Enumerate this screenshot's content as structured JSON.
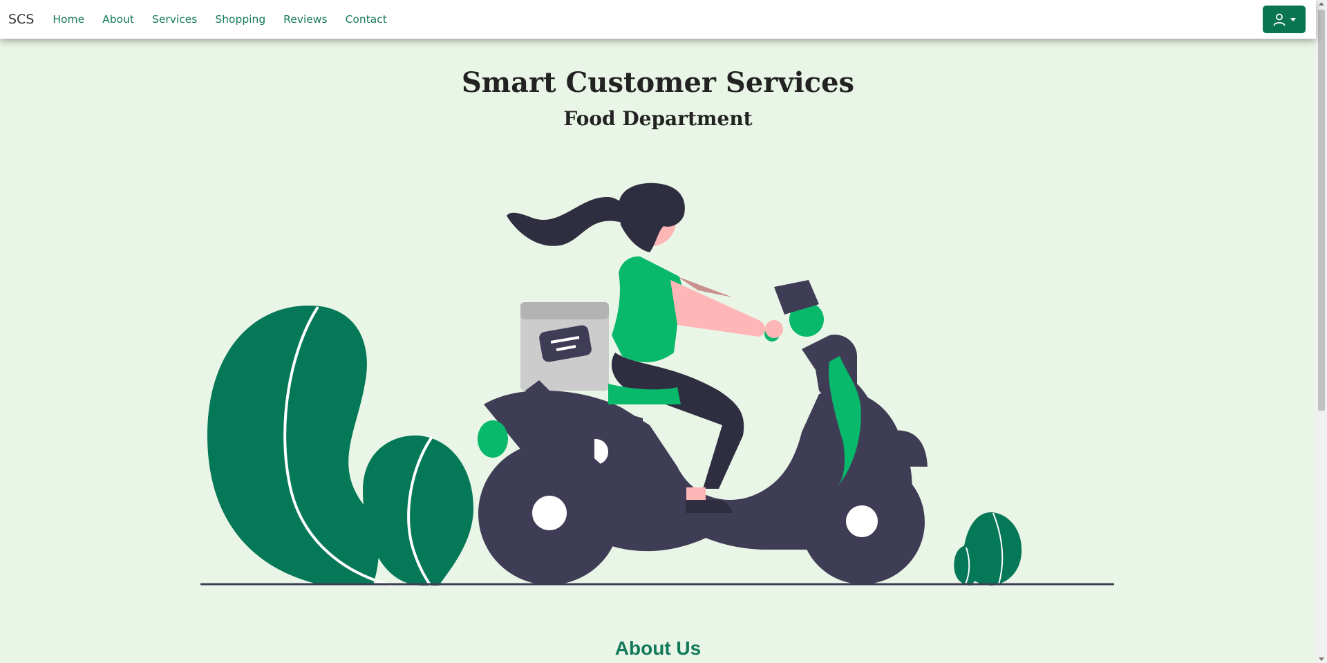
{
  "navbar": {
    "brand": "SCS",
    "links": [
      {
        "label": "Home"
      },
      {
        "label": "About"
      },
      {
        "label": "Services"
      },
      {
        "label": "Shopping"
      },
      {
        "label": "Reviews"
      },
      {
        "label": "Contact"
      }
    ],
    "user_menu_icon": "user-icon"
  },
  "hero": {
    "title": "Smart Customer Services",
    "subtitle": "Food Department"
  },
  "about": {
    "heading": "About Us"
  },
  "colors": {
    "primary": "#0b7451",
    "accent_green": "#08b86b",
    "background": "#e9f5e6",
    "scooter": "#3f3d56",
    "link": "#13795b"
  }
}
